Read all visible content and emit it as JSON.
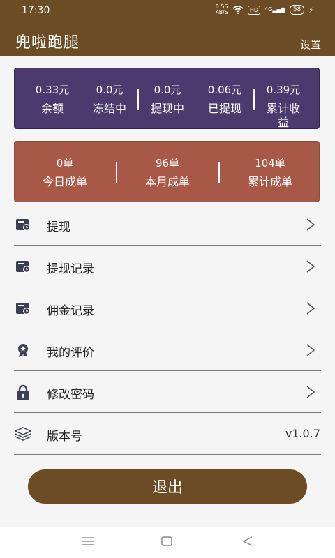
{
  "status_bar": {
    "time": "17:30",
    "net_speed": "0.56",
    "net_unit": "KB/S",
    "hd": "HD",
    "signal": "4G",
    "battery": "58"
  },
  "app_bar": {
    "title": "兜啦跑腿",
    "settings": "设置"
  },
  "earnings": [
    {
      "value": "0.33元",
      "label": "余额"
    },
    {
      "value": "0.0元",
      "label": "冻结中"
    },
    {
      "value": "0.0元",
      "label": "提现中"
    },
    {
      "value": "0.06元",
      "label": "已提现"
    },
    {
      "value": "0.39元",
      "label": "累计收益"
    }
  ],
  "orders": [
    {
      "value": "0单",
      "label": "今日成单"
    },
    {
      "value": "96单",
      "label": "本月成单"
    },
    {
      "value": "104单",
      "label": "累计成单"
    }
  ],
  "menu": [
    {
      "label": "提现",
      "icon": "wallet-clock-icon"
    },
    {
      "label": "提现记录",
      "icon": "wallet-clock-icon"
    },
    {
      "label": "佣金记录",
      "icon": "wallet-clock-icon"
    },
    {
      "label": "我的评价",
      "icon": "badge-star-icon"
    },
    {
      "label": "修改密码",
      "icon": "lock-icon"
    },
    {
      "label": "版本号",
      "icon": "layers-icon",
      "value": "v1.0.7"
    }
  ],
  "logout_label": "退出",
  "colors": {
    "primary": "#6b4c24",
    "earnings_bg": "#4a3a6e",
    "orders_bg": "#a85847"
  }
}
